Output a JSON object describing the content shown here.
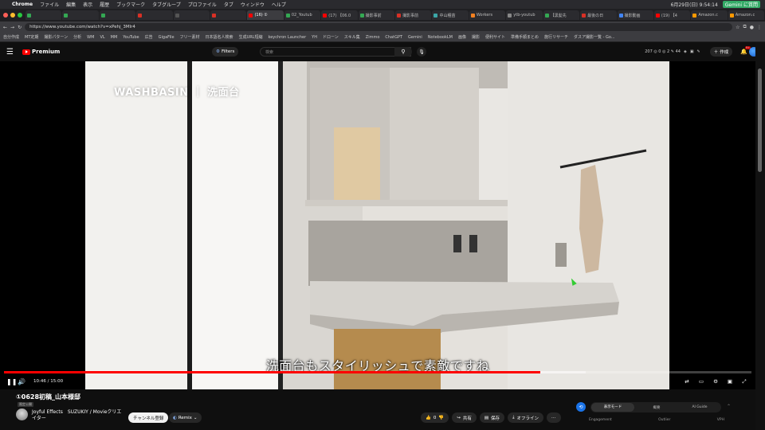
{
  "mac_menu": {
    "app": "Chrome",
    "items": [
      "ファイル",
      "編集",
      "表示",
      "履歴",
      "ブックマーク",
      "タブグループ",
      "プロファイル",
      "タブ",
      "ウィンドウ",
      "ヘルプ"
    ],
    "clock": "6月29日(日) 9:54:14",
    "gemini": "Gemini に質問"
  },
  "tabs": [
    {
      "label": "",
      "color": "#34a853"
    },
    {
      "label": "",
      "color": "#34a853"
    },
    {
      "label": "",
      "color": "#34a853"
    },
    {
      "label": "",
      "color": "#d93025"
    },
    {
      "label": "",
      "color": "#555555"
    },
    {
      "label": "",
      "color": "#d93025"
    },
    {
      "label": "(16) ①",
      "color": "#ff0000",
      "active": true
    },
    {
      "label": "02_Youtub",
      "color": "#34a853"
    },
    {
      "label": "(17) 【06.0",
      "color": "#ff0000"
    },
    {
      "label": "撮影事前",
      "color": "#34a853"
    },
    {
      "label": "撮影事前",
      "color": "#d93025"
    },
    {
      "label": "中山種苗",
      "color": "#3ba6a6"
    },
    {
      "label": "Workers",
      "color": "#f38020"
    },
    {
      "label": "ytb-youtub",
      "color": "#888888"
    },
    {
      "label": "【黒髪先",
      "color": "#34a853"
    },
    {
      "label": "最後の日",
      "color": "#d93025"
    },
    {
      "label": "撮影動画",
      "color": "#4285f4"
    },
    {
      "label": "(19) 【4",
      "color": "#ff0000"
    },
    {
      "label": "Amazon.c",
      "color": "#ff9900"
    },
    {
      "label": "Amazon.c",
      "color": "#ff9900"
    }
  ],
  "address": {
    "url": "https://www.youtube.com/watch?v=xPehj_3Mlr4"
  },
  "bookmarks": [
    "自分作成",
    "MT定期",
    "撮影パターン",
    "分析",
    "WM",
    "VL",
    "MM",
    "YouTube",
    "広告",
    "GigaFile",
    "フリー素材",
    "日本語名人検索",
    "生成URL短縮",
    "keychron Launcher",
    "YH",
    "ドローン",
    "スキル集",
    "Zimmo",
    "ChatGPT",
    "Gemini",
    "NotebookLM",
    "画像",
    "撮影",
    "便利サイト",
    "準備手順まとめ",
    "施行リサーチ",
    "ダスア撮影一覧 - Go..."
  ],
  "yt_header": {
    "logo": "Premium",
    "filters": "Filters",
    "search_placeholder": "検索",
    "stats": "207 ◎ 0 ◎ 2 ✎ 44",
    "create": "作成",
    "notif_count": "9+"
  },
  "video": {
    "overlay_title": "WASHBASIN ｜ 洗面台",
    "caption": "洗面台もスタイリッシュで素敵ですね",
    "current_time": "10:46",
    "duration": "15:00",
    "progress_fraction": 0.717,
    "buffer_fraction": 0.778
  },
  "details": {
    "title": "①0628初稿_山本様邸",
    "visibility": "限定公開",
    "channel": "Joyful Effects　SUZUKIY / Movieクリエイター",
    "subscribe": "チャンネル登録",
    "remix": "Remix",
    "like_count": "0",
    "share": "共有",
    "save": "保存",
    "offline": "オフライン"
  },
  "side_panel": {
    "tabs": [
      "表示モード",
      "概要",
      "AI Guide"
    ],
    "labels": [
      "Engagement",
      "Outlier",
      "VPH"
    ]
  }
}
